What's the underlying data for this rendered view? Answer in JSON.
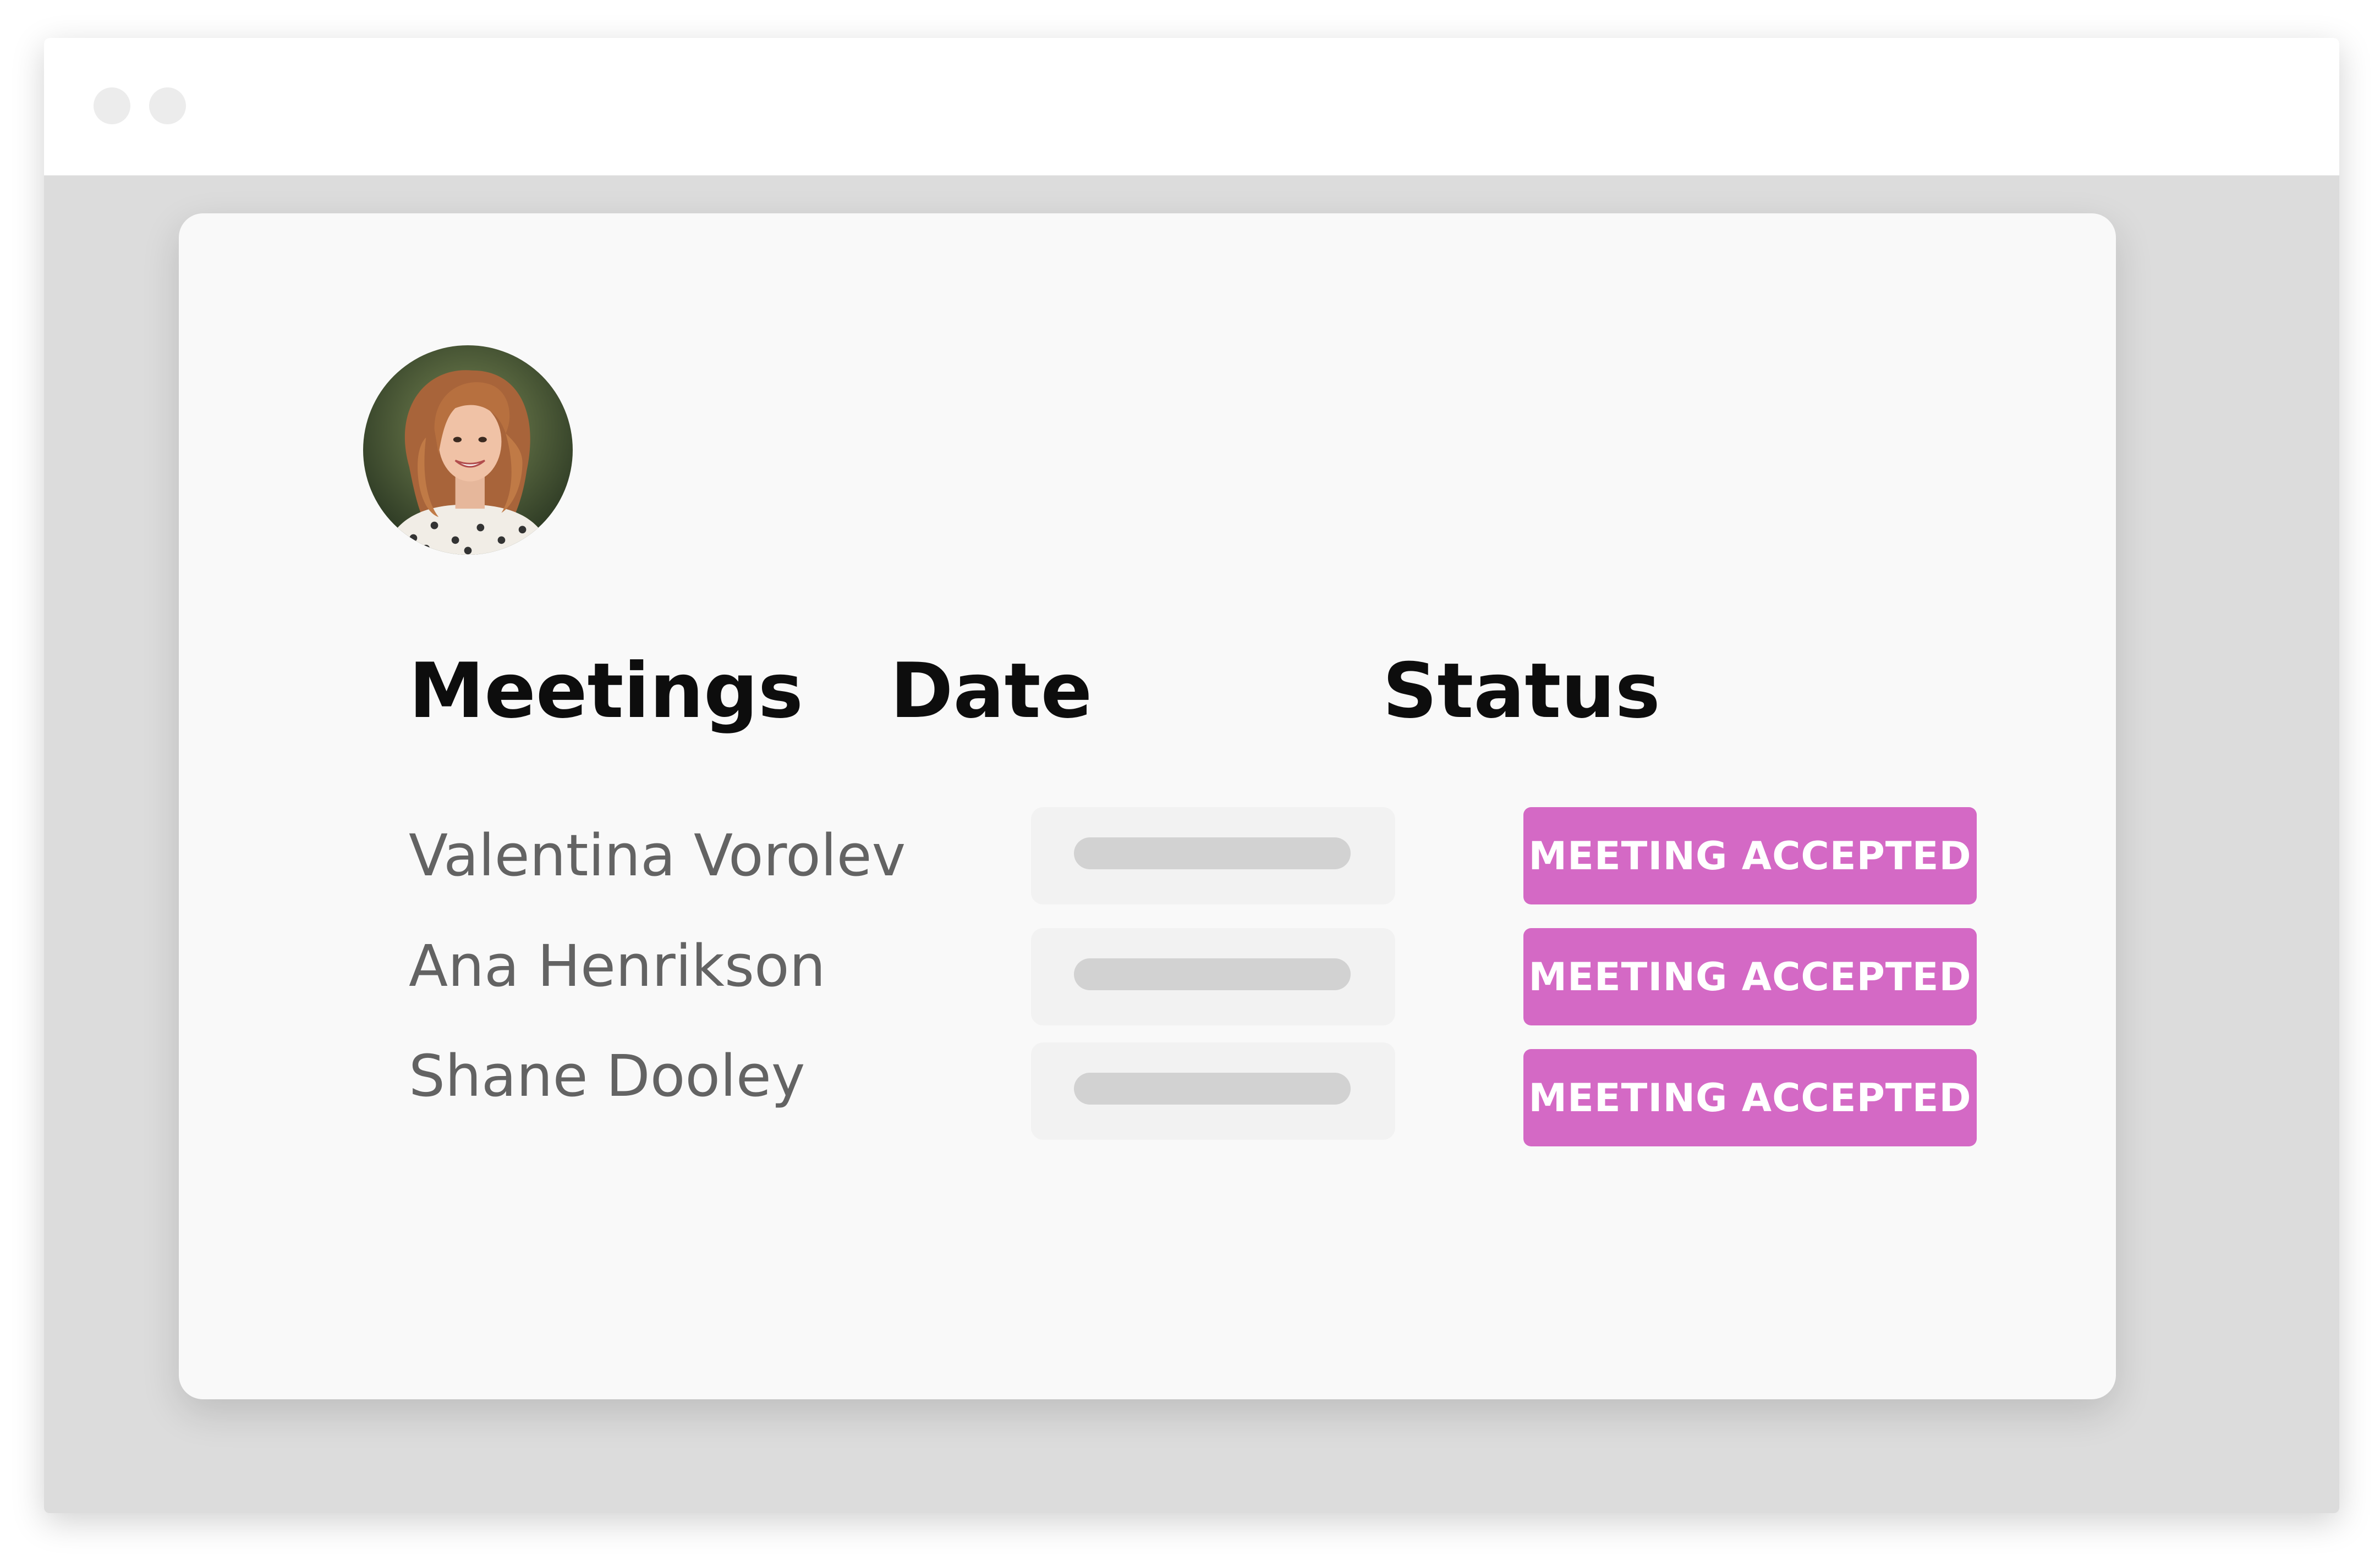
{
  "window": {
    "controls": [
      "window-dot",
      "window-dot"
    ]
  },
  "card": {
    "avatar_icon": "user-photo",
    "headers": {
      "meetings": "Meetings",
      "date": "Date",
      "status": "Status"
    },
    "rows": [
      {
        "name": "Valentina Vorolev",
        "status": "MEETING ACCEPTED"
      },
      {
        "name": "Ana Henrikson",
        "status": "MEETING ACCEPTED"
      },
      {
        "name": "Shane Dooley",
        "status": "MEETING ACCEPTED"
      }
    ]
  },
  "colors": {
    "badge": "#d469c5",
    "card_background": "#f9f9f9",
    "window_background": "#dcdcdc",
    "placeholder": "#d2d2d2"
  }
}
